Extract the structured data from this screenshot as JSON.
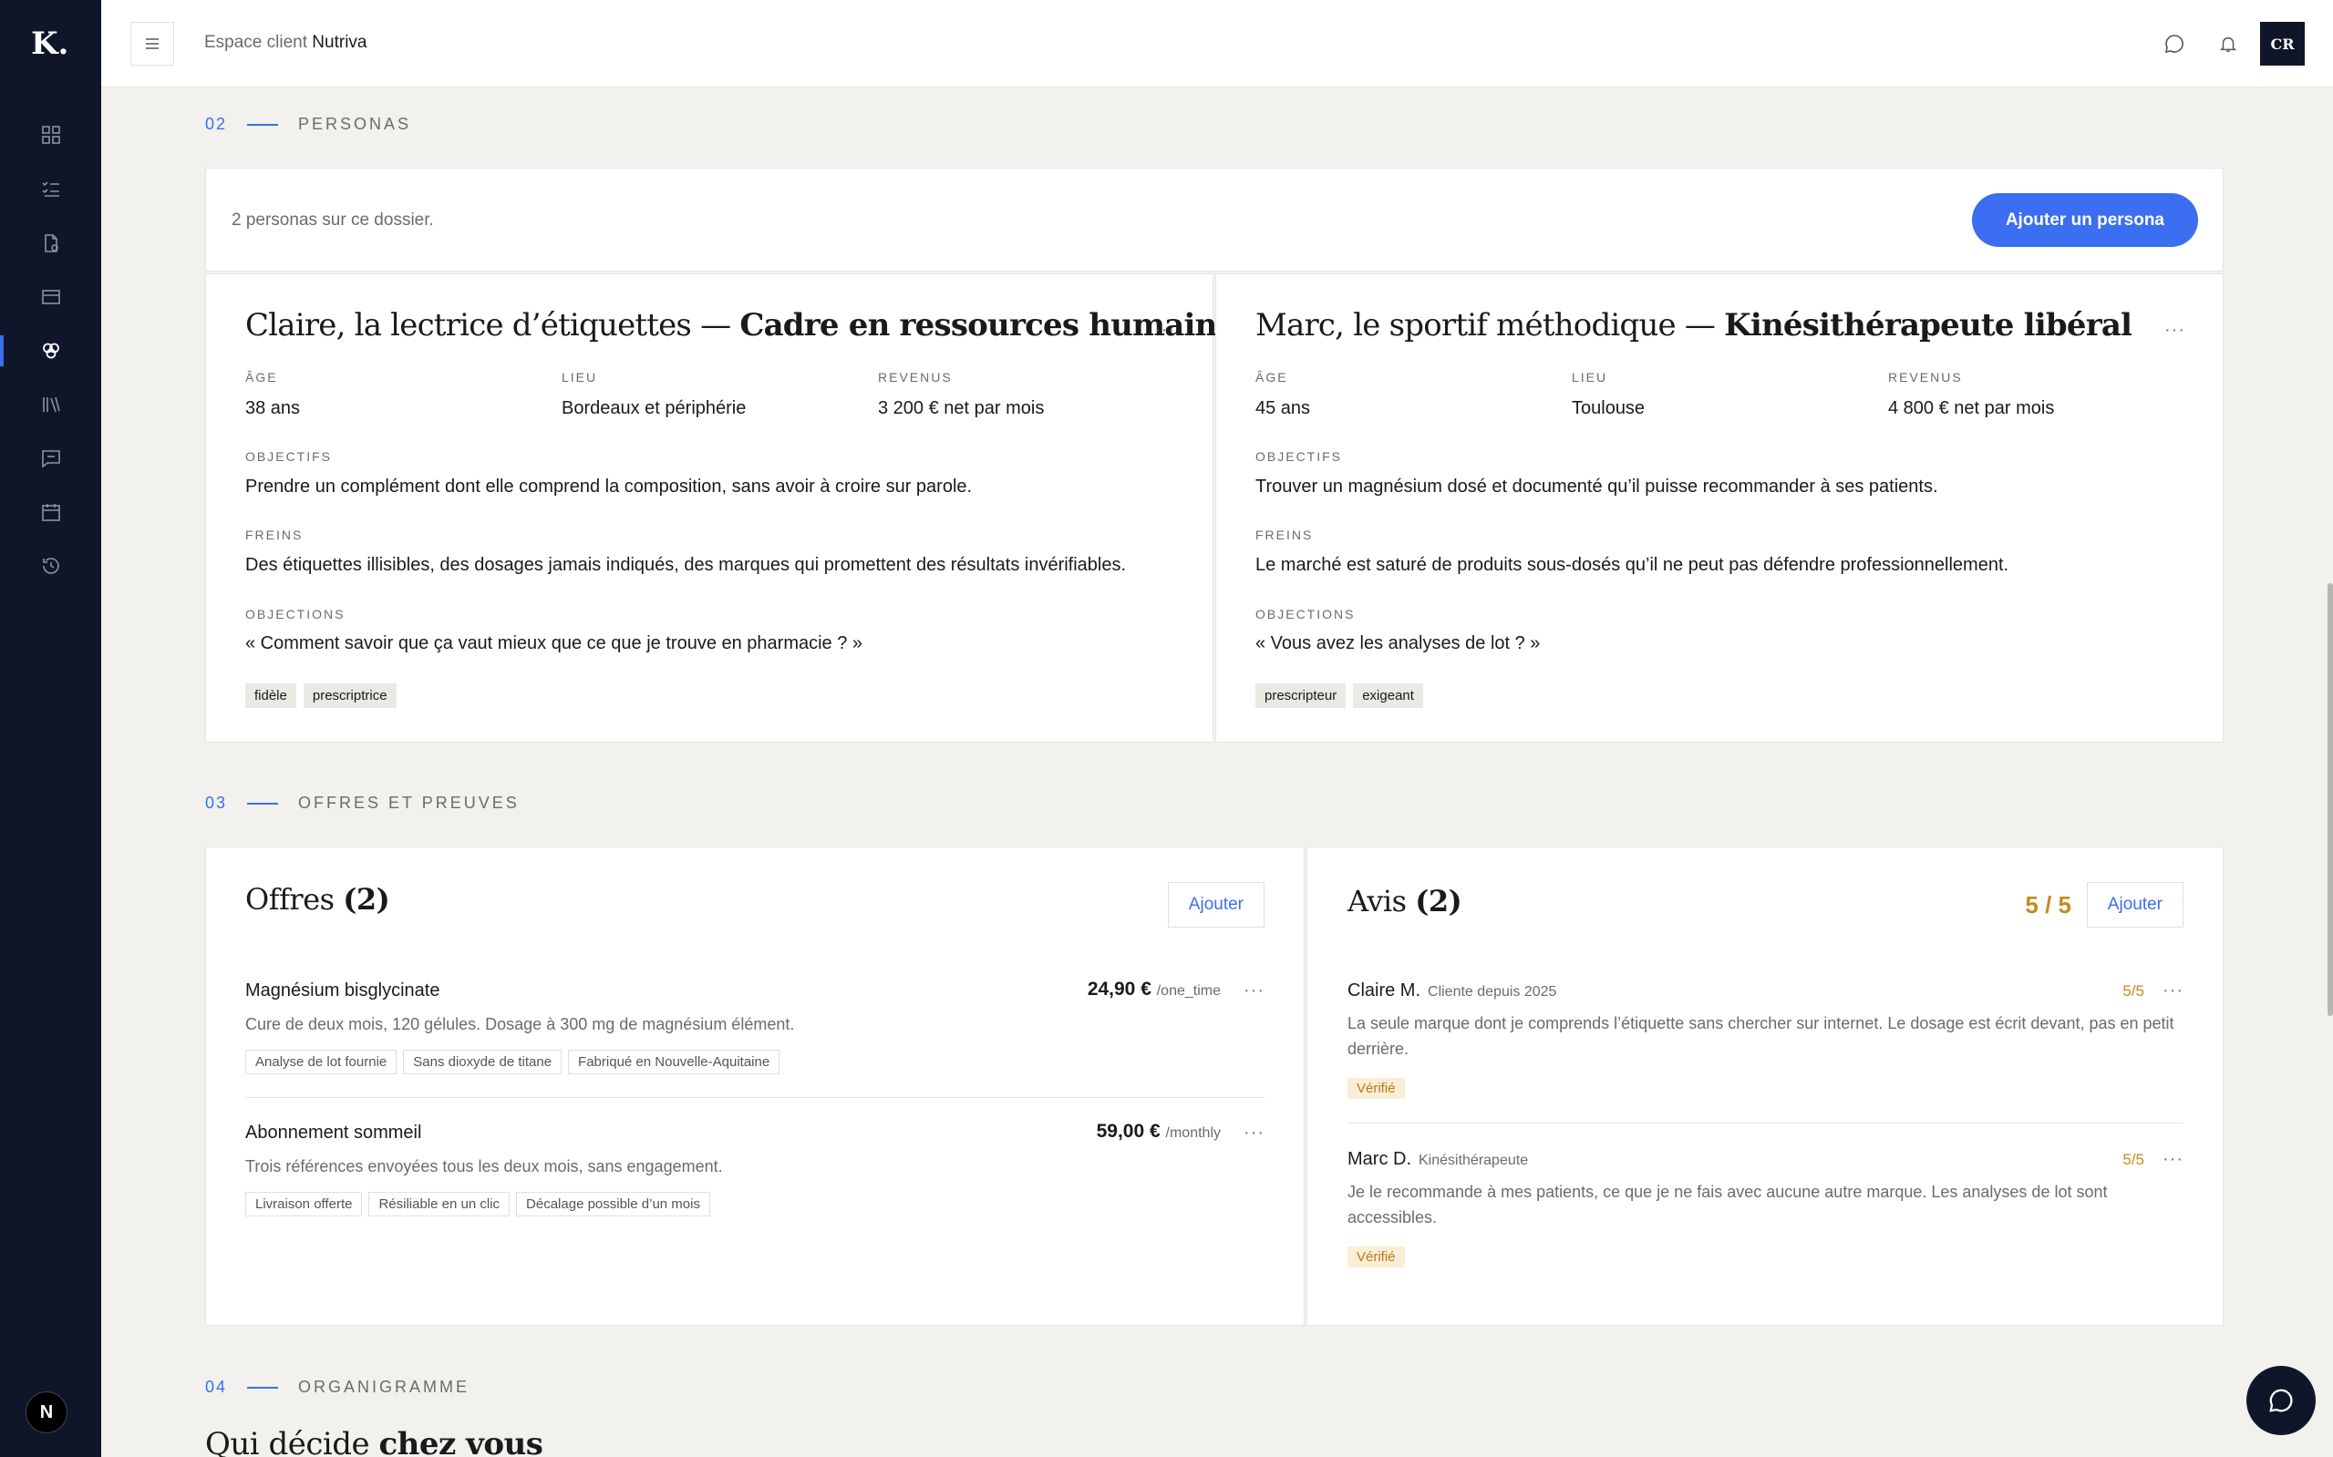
{
  "sidebar": {
    "logo": "K.",
    "items": [
      {
        "name": "dashboard-icon"
      },
      {
        "name": "checklist-icon"
      },
      {
        "name": "document-icon"
      },
      {
        "name": "card-icon"
      },
      {
        "name": "personas-icon",
        "active": true
      },
      {
        "name": "library-icon"
      },
      {
        "name": "message-icon"
      },
      {
        "name": "calendar-icon"
      },
      {
        "name": "history-icon"
      }
    ],
    "bottom_badge": "N"
  },
  "header": {
    "breadcrumb_prefix": "Espace client",
    "breadcrumb_client": "Nutriva",
    "avatar_initials": "CR"
  },
  "sections": {
    "personas": {
      "num": "02",
      "title": "PERSONAS"
    },
    "offres": {
      "num": "03",
      "title": "OFFRES ET PREUVES"
    },
    "organigramme": {
      "num": "04",
      "title": "ORGANIGRAMME",
      "heading_start": "Qui décide ",
      "heading_bold": "chez vous"
    }
  },
  "personas_bar": {
    "count_text": "2 personas sur ce dossier.",
    "add_button": "Ajouter un persona"
  },
  "personas": [
    {
      "title_light": "Claire, la lectrice d’étiquettes — ",
      "title_bold": "Cadre en ressources humaines",
      "age_label": "ÂGE",
      "age": "38 ans",
      "lieu_label": "LIEU",
      "lieu": "Bordeaux et périphérie",
      "revenus_label": "REVENUS",
      "revenus": "3 200 € net par mois",
      "objectifs_label": "OBJECTIFS",
      "objectifs": "Prendre un complément dont elle comprend la composition, sans avoir à croire sur parole.",
      "freins_label": "FREINS",
      "freins": "Des étiquettes illisibles, des dosages jamais indiqués, des marques qui promettent des résultats invérifiables.",
      "objections_label": "OBJECTIONS",
      "objections": "« Comment savoir que ça vaut mieux que ce que je trouve en pharmacie ? »",
      "tags": [
        "fidèle",
        "prescriptrice"
      ],
      "menu": "···"
    },
    {
      "title_light": "Marc, le sportif méthodique — ",
      "title_bold": "Kinésithérapeute libéral",
      "age_label": "ÂGE",
      "age": "45 ans",
      "lieu_label": "LIEU",
      "lieu": "Toulouse",
      "revenus_label": "REVENUS",
      "revenus": "4 800 € net par mois",
      "objectifs_label": "OBJECTIFS",
      "objectifs": "Trouver un magnésium dosé et documenté qu’il puisse recommander à ses patients.",
      "freins_label": "FREINS",
      "freins": "Le marché est saturé de produits sous-dosés qu’il ne peut pas défendre professionnellement.",
      "objections_label": "OBJECTIONS",
      "objections": "« Vous avez les analyses de lot ? »",
      "tags": [
        "prescripteur",
        "exigeant"
      ],
      "menu": "···"
    }
  ],
  "offres": {
    "title": "Offres ",
    "count": "(2)",
    "add_button": "Ajouter",
    "items": [
      {
        "name": "Magnésium bisglycinate",
        "price": "24,90 €",
        "period": "/one_time",
        "desc": "Cure de deux mois, 120 gélules. Dosage à 300 mg de magnésium élément.",
        "tags": [
          "Analyse de lot fournie",
          "Sans dioxyde de titane",
          "Fabriqué en Nouvelle-Aquitaine"
        ],
        "menu": "···"
      },
      {
        "name": "Abonnement sommeil",
        "price": "59,00 €",
        "period": "/monthly",
        "desc": "Trois références envoyées tous les deux mois, sans engagement.",
        "tags": [
          "Livraison offerte",
          "Résiliable en un clic",
          "Décalage possible d’un mois"
        ],
        "menu": "···"
      }
    ]
  },
  "avis": {
    "title": "Avis ",
    "count": "(2)",
    "score": "5 / 5",
    "add_button": "Ajouter",
    "items": [
      {
        "author": "Claire M.",
        "role": "Cliente depuis 2025",
        "score": "5/5",
        "text": "La seule marque dont je comprends l’étiquette sans chercher sur internet. Le dosage est écrit devant, pas en petit derrière.",
        "badge": "Vérifié",
        "menu": "···"
      },
      {
        "author": "Marc D.",
        "role": "Kinésithérapeute",
        "score": "5/5",
        "text": "Je le recommande à mes patients, ce que je ne fais avec aucune autre marque. Les analyses de lot sont accessibles.",
        "badge": "Vérifié",
        "menu": "···"
      }
    ]
  },
  "colors": {
    "accent": "#3b6ef0",
    "sidebar": "#0f1629",
    "background": "#f2f1ed",
    "rating": "#c78a1f"
  }
}
